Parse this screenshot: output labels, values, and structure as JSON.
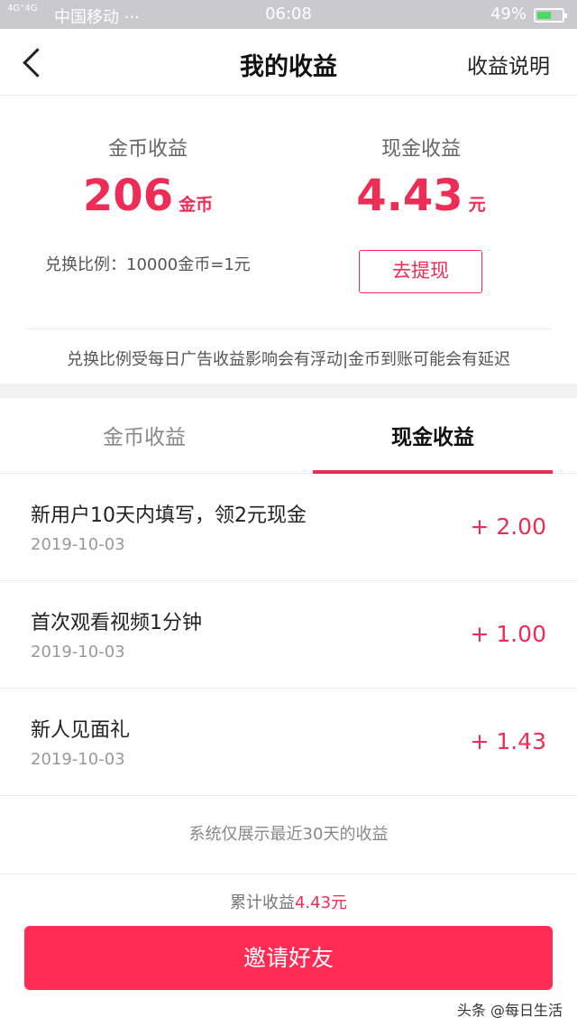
{
  "status_bar": {
    "signal": "4G⁺4G",
    "carrier": "中国移动 ···",
    "time": "06:08",
    "battery": "49%",
    "battery_level": 0.49
  },
  "nav": {
    "title": "我的收益",
    "help": "收益说明"
  },
  "summary": {
    "coin_label": "金币收益",
    "coin_value": "206",
    "coin_unit": "金币",
    "cash_label": "现金收益",
    "cash_value": "4.43",
    "cash_unit": "元",
    "rate": "兑换比例：10000金币=1元",
    "withdraw": "去提现",
    "notice": "兑换比例受每日广告收益影响会有浮动|金币到账可能会有延迟"
  },
  "tabs": [
    {
      "label": "金币收益",
      "active": false
    },
    {
      "label": "现金收益",
      "active": true
    }
  ],
  "records": [
    {
      "title": "新用户10天内填写，领2元现金",
      "date": "2019-10-03",
      "amount": "+ 2.00"
    },
    {
      "title": "首次观看视频1分钟",
      "date": "2019-10-03",
      "amount": "+ 1.00"
    },
    {
      "title": "新人见面礼",
      "date": "2019-10-03",
      "amount": "+ 1.43"
    }
  ],
  "footer_note": "系统仅展示最近30天的收益",
  "total": {
    "label": "累计收益",
    "amount": "4.43元"
  },
  "invite_button": "邀请好友",
  "watermark": "头条 @每日生活",
  "colors": {
    "accent": "#ee2d56",
    "button": "#fe2c55"
  }
}
